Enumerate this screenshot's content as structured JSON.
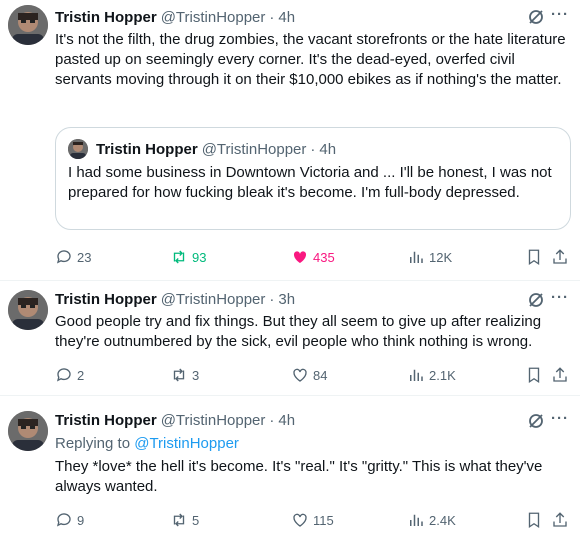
{
  "tweets": [
    {
      "name": "Tristin Hopper",
      "handle": "@TristinHopper",
      "dot": "·",
      "time": "4h",
      "more": "···",
      "text": "It's not the filth, the drug zombies, the vacant storefronts or the hate literature pasted up on seemingly every corner. It's the dead-eyed, overfed civil servants moving through it on their $10,000 ebikes as if nothing's the matter.",
      "quote": {
        "name": "Tristin Hopper",
        "handle": "@TristinHopper",
        "dot": "·",
        "time": "4h",
        "text": "I had some business in Downtown Victoria and ... I'll be honest, I was not prepared for how fucking bleak it's become. I'm full-body depressed."
      },
      "replies": "23",
      "reposts": "93",
      "likes": "435",
      "liked": true,
      "views": "12K"
    },
    {
      "name": "Tristin Hopper",
      "handle": "@TristinHopper",
      "dot": "·",
      "time": "3h",
      "more": "···",
      "text": "Good people try and fix things. But they all seem to give up after realizing they're outnumbered by the sick, evil people who think nothing is wrong.",
      "replies": "2",
      "reposts": "3",
      "likes": "84",
      "views": "2.1K"
    },
    {
      "name": "Tristin Hopper",
      "handle": "@TristinHopper",
      "dot": "·",
      "time": "4h",
      "more": "···",
      "replying_prefix": "Replying to",
      "replying_handle": "@TristinHopper",
      "text": "They *love* the hell it's become. It's \"real.\" It's \"gritty.\" This is what they've always wanted.",
      "replies": "9",
      "reposts": "5",
      "likes": "115",
      "views": "2.4K"
    }
  ],
  "icons": {
    "grok": "grok-icon",
    "more": "more-icon",
    "reply": "reply-icon",
    "repost": "repost-icon",
    "like": "heart-icon",
    "views": "views-icon",
    "bookmark": "bookmark-icon",
    "share": "share-icon"
  },
  "colors": {
    "text": "#0f1419",
    "secondary": "#536471",
    "link": "#1d9bf0",
    "repost": "#00ba7c",
    "like": "#f91880",
    "border": "#cfd9de"
  }
}
